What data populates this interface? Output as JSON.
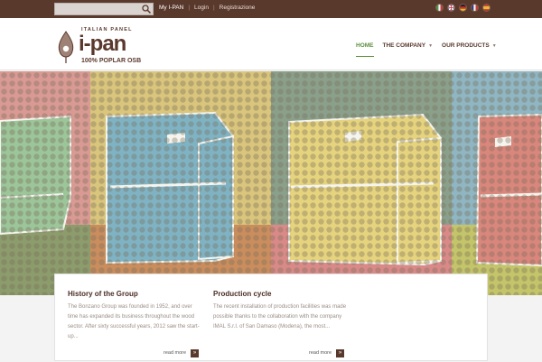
{
  "topbar": {
    "search_placeholder": "",
    "links": [
      "My I-PAN",
      "Login",
      "Registrazione"
    ],
    "languages": [
      "Italiano",
      "English",
      "Deutsch",
      "Français",
      "Español"
    ]
  },
  "logo": {
    "tagline": "ITALIAN PANEL",
    "brand": "i-pan",
    "subtitle": "100% POPLAR OSB"
  },
  "nav": {
    "items": [
      {
        "label": "HOME",
        "active": true,
        "dropdown": false
      },
      {
        "label": "THE COMPANY",
        "active": false,
        "dropdown": true
      },
      {
        "label": "OUR PRODUCTS",
        "active": false,
        "dropdown": true
      }
    ]
  },
  "cards": [
    {
      "title": "History of the Group",
      "text": "The Bonzano Group was founded in 1952, and over time has expanded its business throughout the wood sector. After sixty successful years, 2012 saw the start-up...",
      "more": "read more"
    },
    {
      "title": "Production cycle",
      "text": "The recent installation of production facilities was made possible thanks to the collaboration with the company IMAL S.r.l. of San Damaso (Modena), the most...",
      "more": "read more"
    }
  ],
  "colors": {
    "topbar": "#5a392d",
    "accent_green": "#5b8f3a",
    "brand_brown": "#5a392d"
  }
}
